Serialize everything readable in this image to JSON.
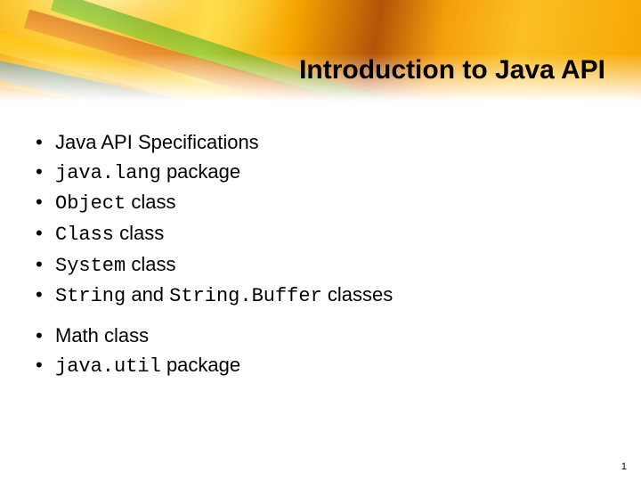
{
  "title": "Introduction to Java API",
  "group1": {
    "b0": {
      "t0": "Java API Specifications"
    },
    "b1": {
      "m0": "java.lang",
      "t0": " package"
    },
    "b2": {
      "m0": "Object",
      "t0": " class"
    },
    "b3": {
      "m0": "Class",
      "t0": " class"
    },
    "b4": {
      "m0": "System",
      "t0": " class"
    },
    "b5": {
      "m0": "String",
      "t0": " and ",
      "m1": "String.Buffer",
      "t1": " classes"
    }
  },
  "group2": {
    "b0": {
      "t0": "Math class"
    },
    "b1": {
      "m0": "java.util",
      "t0": " package"
    }
  },
  "pagenum": "1"
}
